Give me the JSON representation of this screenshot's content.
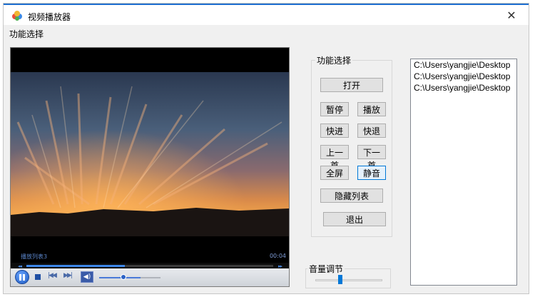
{
  "window": {
    "title": "视频播放器",
    "close_glyph": "✕"
  },
  "menu": {
    "items": [
      {
        "label": "功能选择"
      }
    ]
  },
  "player": {
    "track_label": "播放列表3",
    "time": "00:04",
    "seek_left_glyph": "◂◂",
    "seek_right_glyph": "▸▸",
    "seek_progress": 0.4,
    "controls": {
      "prev_glyph": "|◀◀",
      "next_glyph": "▶▶|",
      "mute_glyph": "◀)",
      "volume_level": 0.4
    }
  },
  "function_group": {
    "legend": "功能选择",
    "buttons": {
      "open": "打开",
      "pause": "暂停",
      "play": "播放",
      "fast_forward": "快进",
      "rewind": "快退",
      "previous": "上一首",
      "next": "下一首",
      "fullscreen": "全屏",
      "mute": "静音",
      "hide_list": "隐藏列表",
      "exit": "退出"
    }
  },
  "volume": {
    "label": "音量调节",
    "level": 0.4
  },
  "playlist": {
    "items": [
      "C:\\Users\\yangjie\\Desktop",
      "C:\\Users\\yangjie\\Desktop",
      "C:\\Users\\yangjie\\Desktop"
    ]
  },
  "icons": {
    "app": "app-icon",
    "close": "close-icon",
    "play_pause": "pause-icon",
    "stop": "stop-icon",
    "prev": "previous-track-icon",
    "next": "next-track-icon",
    "mute": "speaker-icon"
  },
  "colors": {
    "accent": "#0078d7",
    "seek_fill": "#3c86e8"
  }
}
